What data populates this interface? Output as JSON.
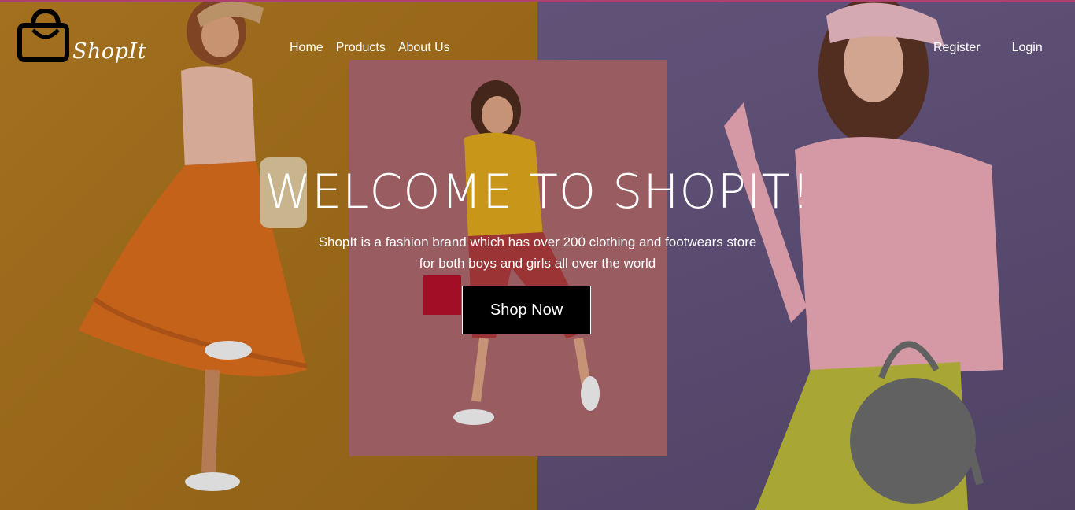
{
  "brand": {
    "name": "ShopIt",
    "logo_icon": "shopping-bag-icon"
  },
  "nav": {
    "left": [
      {
        "label": "Home"
      },
      {
        "label": "Products"
      },
      {
        "label": "About Us"
      }
    ],
    "right": [
      {
        "label": "Register"
      },
      {
        "label": "Login"
      }
    ]
  },
  "hero": {
    "title": "WELCOME TO SHOPIT!",
    "subtitle_line1": "ShopIt is a fashion brand which has over 200 clothing and footwears store",
    "subtitle_line2": "for both boys and girls all over the world",
    "cta_label": "Shop Now"
  },
  "colors": {
    "left_panel": "#a8731f",
    "center_panel": "#a5646a",
    "right_panel": "#6a5a83",
    "cta_bg": "#000000"
  }
}
